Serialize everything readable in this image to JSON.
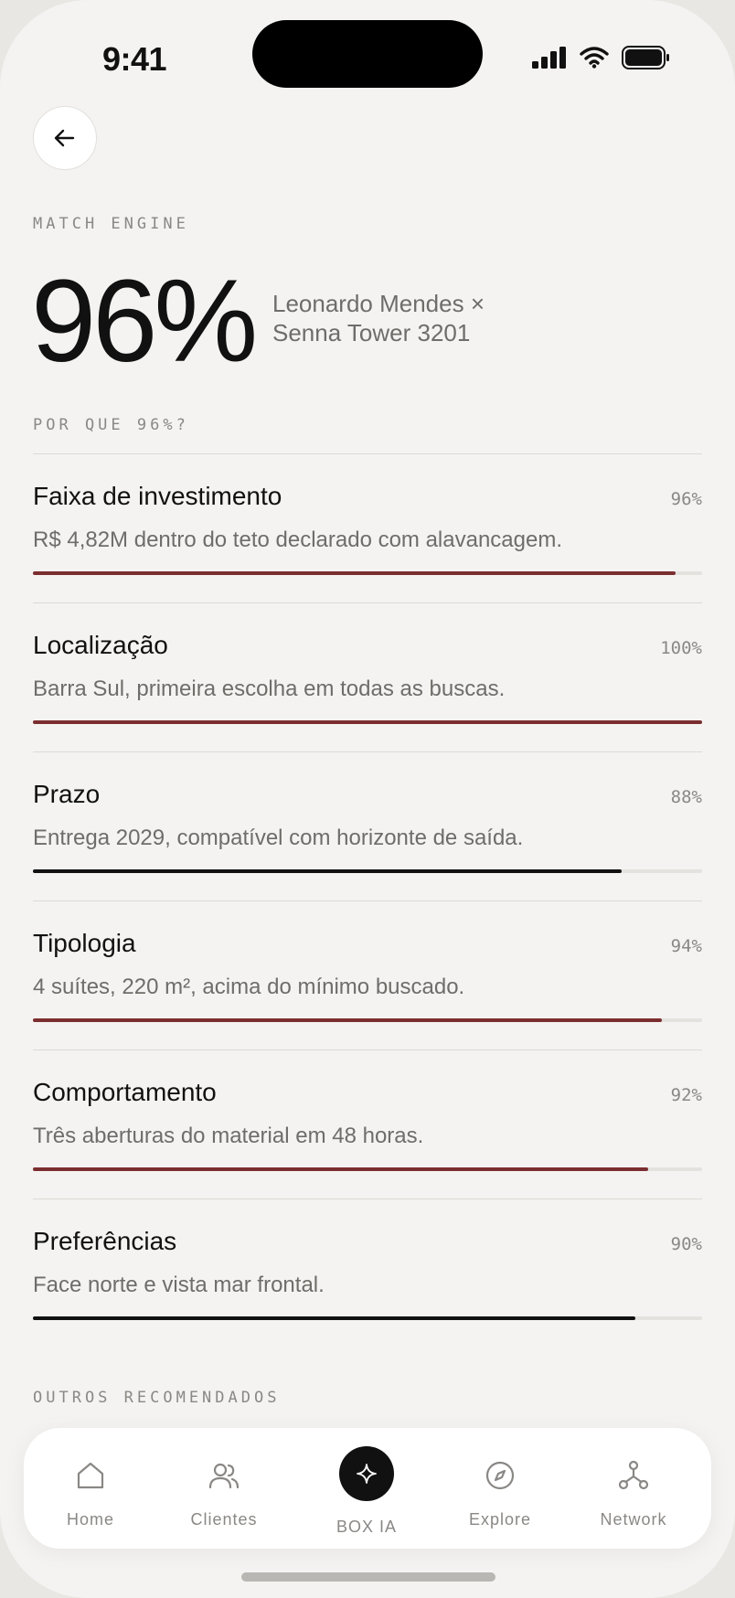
{
  "status_bar": {
    "time": "9:41"
  },
  "header": {
    "back_icon": "arrow-left-icon"
  },
  "match": {
    "eyebrow": "MATCH ENGINE",
    "score": "96%",
    "client": "Leonardo Mendes ×",
    "property": "Senna Tower 3201"
  },
  "reasons": {
    "heading": "POR QUE 96%?",
    "items": [
      {
        "title": "Faixa de investimento",
        "percent": "96%",
        "value": 0.96,
        "desc": "R$ 4,82M dentro do teto declarado com alavancagem.",
        "color": "#7b2e30"
      },
      {
        "title": "Localização",
        "percent": "100%",
        "value": 1.0,
        "desc": "Barra Sul, primeira escolha em todas as buscas.",
        "color": "#7b2e30"
      },
      {
        "title": "Prazo",
        "percent": "88%",
        "value": 0.88,
        "desc": "Entrega 2029, compatível com horizonte de saída.",
        "color": "#111111"
      },
      {
        "title": "Tipologia",
        "percent": "94%",
        "value": 0.94,
        "desc": "4 suítes, 220 m², acima do mínimo buscado.",
        "color": "#7b2e30"
      },
      {
        "title": "Comportamento",
        "percent": "92%",
        "value": 0.92,
        "desc": "Três aberturas do material em 48 horas.",
        "color": "#7b2e30"
      },
      {
        "title": "Preferências",
        "percent": "90%",
        "value": 0.9,
        "desc": "Face norte e vista mar frontal.",
        "color": "#111111"
      }
    ]
  },
  "others": {
    "heading": "OUTROS RECOMENDADOS"
  },
  "nav": {
    "items": [
      {
        "label": "Home",
        "icon": "home-icon"
      },
      {
        "label": "Clientes",
        "icon": "users-icon"
      },
      {
        "label": "BOX IA",
        "icon": "sparkle-icon"
      },
      {
        "label": "Explore",
        "icon": "compass-icon"
      },
      {
        "label": "Network",
        "icon": "network-icon"
      }
    ]
  },
  "colors": {
    "accent": "#7b2e30",
    "background": "#f4f3f1",
    "ink": "#111111"
  }
}
